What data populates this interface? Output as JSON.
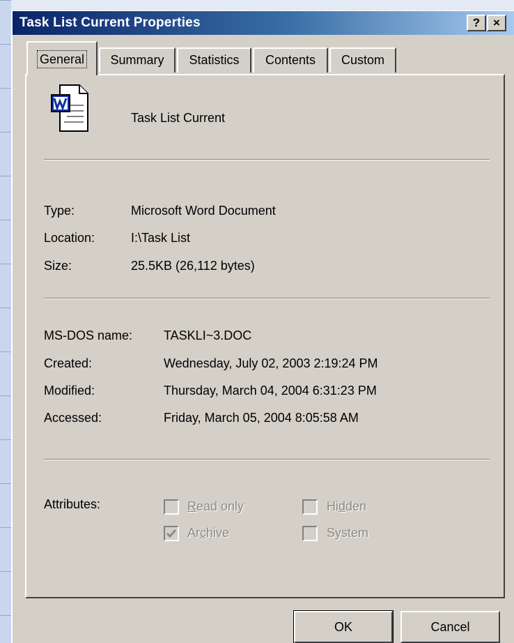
{
  "window": {
    "title": "Task List Current Properties",
    "help_label": "?",
    "close_label": "×"
  },
  "tabs": [
    {
      "label": "General",
      "active": true
    },
    {
      "label": "Summary",
      "active": false
    },
    {
      "label": "Statistics",
      "active": false
    },
    {
      "label": "Contents",
      "active": false
    },
    {
      "label": "Custom",
      "active": false
    }
  ],
  "file": {
    "icon": "word-document-icon",
    "name": "Task List Current"
  },
  "details": {
    "type_label": "Type:",
    "type_value": "Microsoft Word Document",
    "location_label": "Location:",
    "location_value": "I:\\Task List",
    "size_label": "Size:",
    "size_value": "25.5KB (26,112 bytes)"
  },
  "dates": {
    "msdos_label": "MS-DOS name:",
    "msdos_value": "TASKLI~3.DOC",
    "created_label": "Created:",
    "created_value": "Wednesday, July 02, 2003 2:19:24 PM",
    "modified_label": "Modified:",
    "modified_value": "Thursday, March 04, 2004 6:31:23 PM",
    "accessed_label": "Accessed:",
    "accessed_value": "Friday, March 05, 2004 8:05:58 AM"
  },
  "attributes": {
    "label": "Attributes:",
    "read_only": {
      "pre": "",
      "key": "R",
      "post": "ead only",
      "checked": false
    },
    "hidden": {
      "pre": "Hi",
      "key": "d",
      "post": "den",
      "checked": false
    },
    "archive": {
      "pre": "Ar",
      "key": "c",
      "post": "hive",
      "checked": true
    },
    "system": {
      "pre": "",
      "key": "",
      "post": "System",
      "checked": false
    }
  },
  "buttons": {
    "ok": "OK",
    "cancel": "Cancel"
  },
  "colors": {
    "titlebar_start": "#0a246a",
    "titlebar_end": "#a6caf0",
    "dialog_face": "#d4d0c8",
    "disabled_text": "#8c8a84"
  }
}
